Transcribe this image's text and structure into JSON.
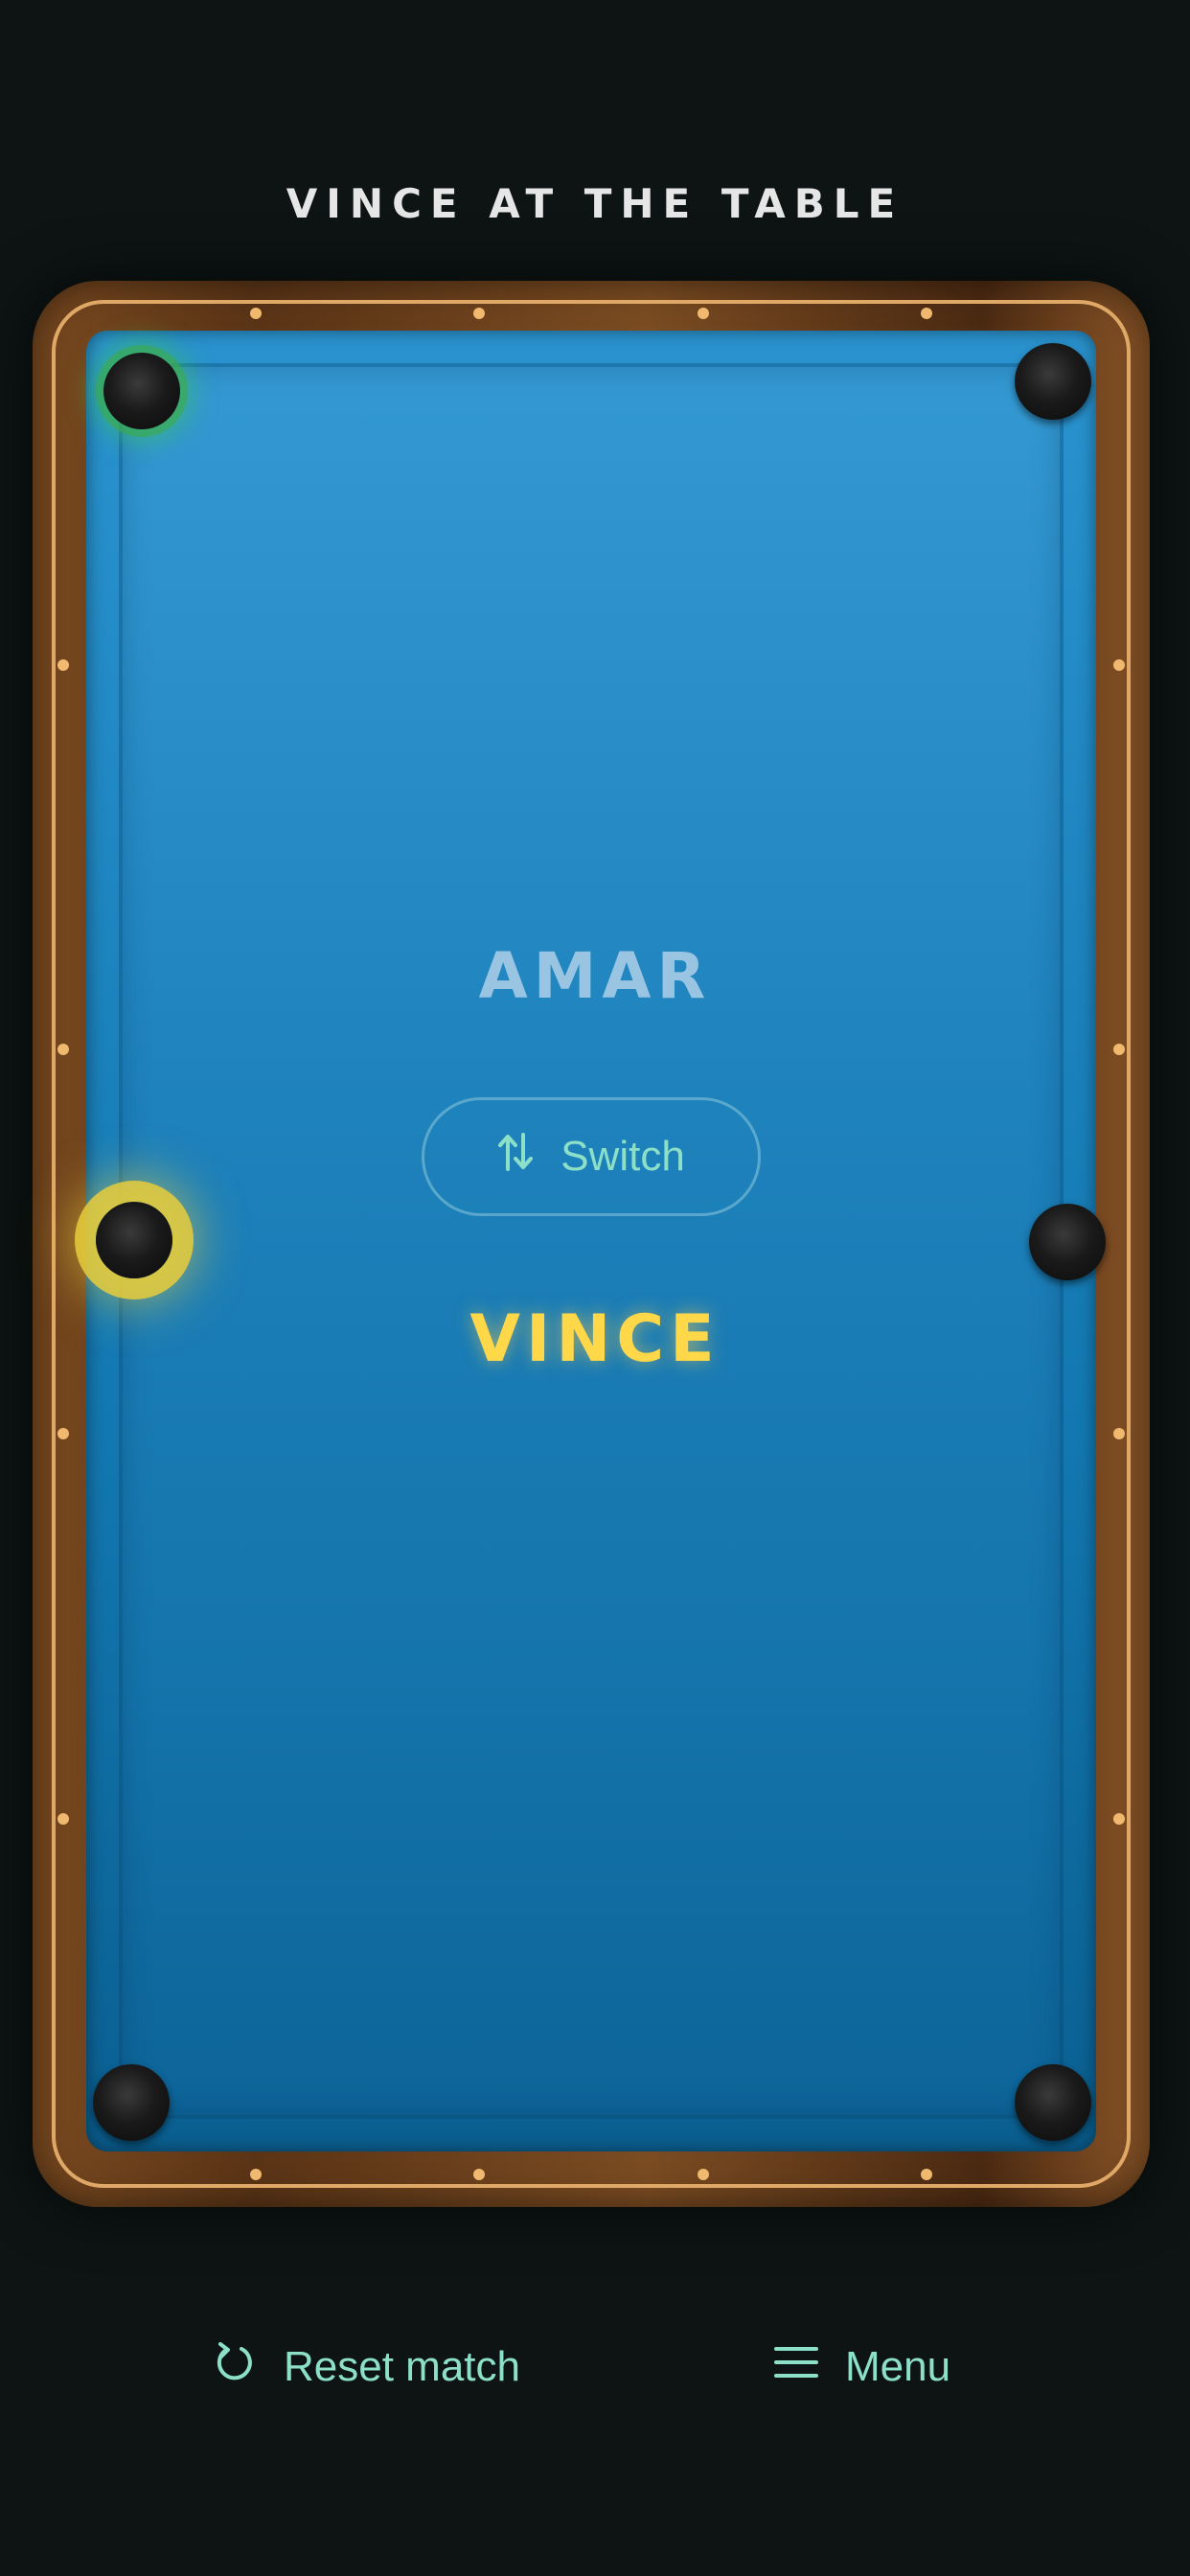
{
  "header": {
    "title": "VINCE AT THE TABLE"
  },
  "players": {
    "top": "AMAR",
    "bottom": "VINCE",
    "active": "VINCE"
  },
  "switch_button": {
    "label": "Switch",
    "icon": "swap-vertical-icon"
  },
  "bottom_bar": {
    "reset_label": "Reset match",
    "reset_icon": "refresh-icon",
    "menu_label": "Menu",
    "menu_icon": "hamburger-menu-icon"
  },
  "colors": {
    "background": "#0d1413",
    "felt": "#1f83bd",
    "rail": "#6b3f1b",
    "active_player": "#ffd84a",
    "inactive_player": "#a8cce6",
    "accent": "#8de0c8",
    "highlight_green": "#3cc850",
    "highlight_yellow": "#e6cd3c"
  }
}
